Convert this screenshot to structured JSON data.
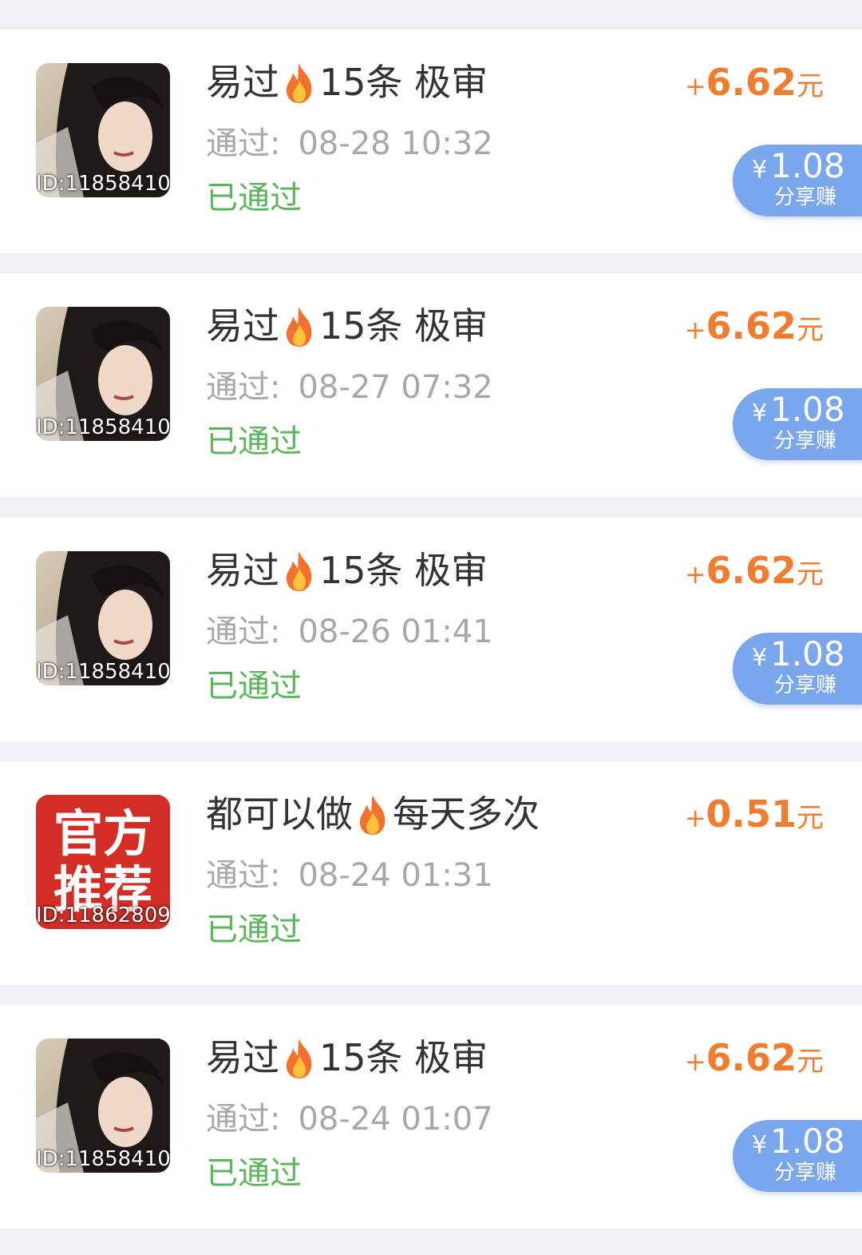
{
  "colors": {
    "page_background": "#efeff4",
    "card_background": "#ffffff",
    "title_text": "#333333",
    "time_text": "#a8a8a8",
    "status_green": "#5bb55b",
    "amount_orange": "#ef7d2d",
    "share_pill_blue": "#79a6ec"
  },
  "items": [
    {
      "thumbnail": "portrait-photo",
      "thumb_id": "ID:11858410",
      "title_before": "易过",
      "title_icon": "fire-icon",
      "title_after": "15条 极审",
      "time_label": "通过:",
      "time_value": "08-28 10:32",
      "status": "已通过",
      "amount_plus": "+",
      "amount_value": "6.62",
      "amount_unit": "元",
      "share": {
        "currency": "¥",
        "amount": "1.08",
        "label": "分享赚"
      }
    },
    {
      "thumbnail": "portrait-photo",
      "thumb_id": "ID:11858410",
      "title_before": "易过",
      "title_icon": "fire-icon",
      "title_after": "15条 极审",
      "time_label": "通过:",
      "time_value": "08-27 07:32",
      "status": "已通过",
      "amount_plus": "+",
      "amount_value": "6.62",
      "amount_unit": "元",
      "share": {
        "currency": "¥",
        "amount": "1.08",
        "label": "分享赚"
      }
    },
    {
      "thumbnail": "portrait-photo",
      "thumb_id": "ID:11858410",
      "title_before": "易过",
      "title_icon": "fire-icon",
      "title_after": "15条 极审",
      "time_label": "通过:",
      "time_value": "08-26 01:41",
      "status": "已通过",
      "amount_plus": "+",
      "amount_value": "6.62",
      "amount_unit": "元",
      "share": {
        "currency": "¥",
        "amount": "1.08",
        "label": "分享赚"
      }
    },
    {
      "thumbnail": "official-recommend-badge",
      "thumb_badge_line1": "官方",
      "thumb_badge_line2": "推荐",
      "thumb_id": "ID:11862809",
      "title_before": "都可以做",
      "title_icon": "fire-icon",
      "title_after": "每天多次",
      "time_label": "通过:",
      "time_value": "08-24 01:31",
      "status": "已通过",
      "amount_plus": "+",
      "amount_value": "0.51",
      "amount_unit": "元"
    },
    {
      "thumbnail": "portrait-photo",
      "thumb_id": "ID:11858410",
      "title_before": "易过",
      "title_icon": "fire-icon",
      "title_after": "15条 极审",
      "time_label": "通过:",
      "time_value": "08-24 01:07",
      "status": "已通过",
      "amount_plus": "+",
      "amount_value": "6.62",
      "amount_unit": "元",
      "share": {
        "currency": "¥",
        "amount": "1.08",
        "label": "分享赚"
      }
    }
  ]
}
